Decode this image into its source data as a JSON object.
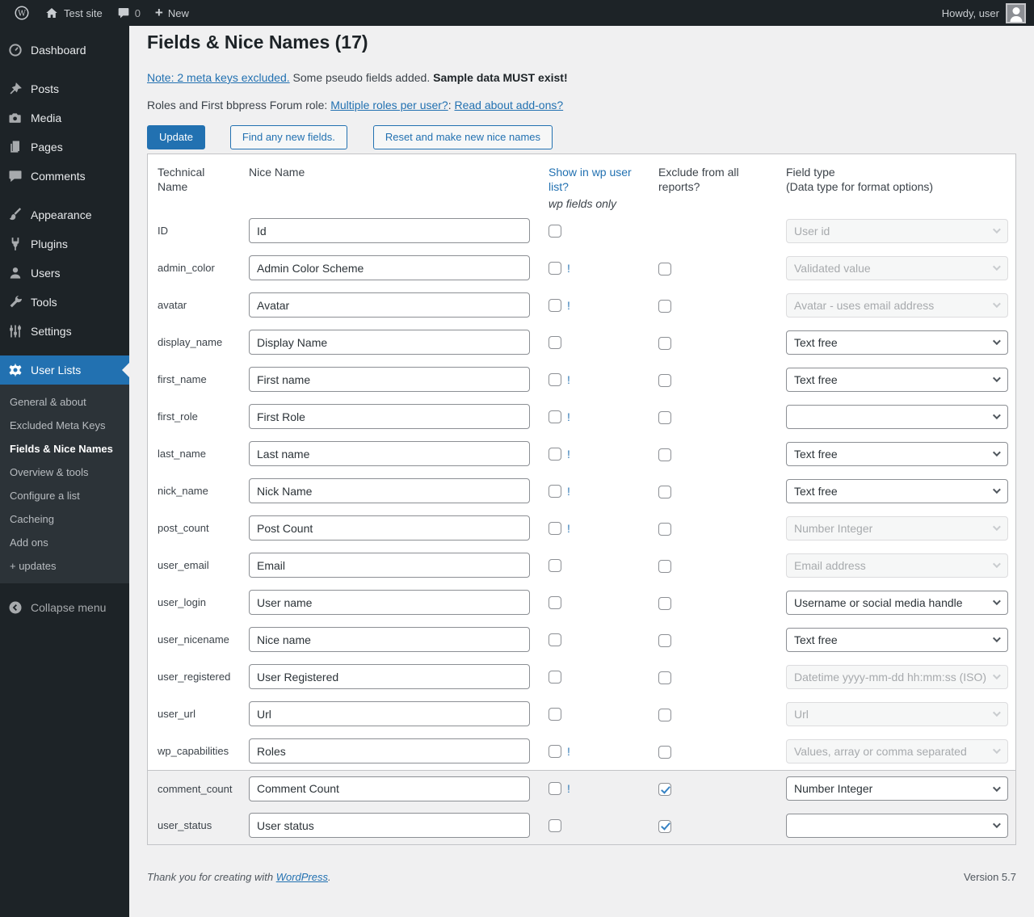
{
  "colors": {
    "accent": "#2271b1",
    "admin_dark": "#1d2327",
    "submenu_bg": "#2c3338",
    "content_bg": "#f0f0f1",
    "check_blue": "#3582c4"
  },
  "admin_bar": {
    "site_name": "Test site",
    "comment_count": "0",
    "new_label": "New",
    "howdy": "Howdy, user"
  },
  "sidebar": {
    "items": [
      {
        "label": "Dashboard",
        "icon": "dashboard-icon",
        "sep": false,
        "active": false
      },
      {
        "label": "Posts",
        "icon": "pushpin-icon",
        "sep": true,
        "active": false
      },
      {
        "label": "Media",
        "icon": "camera-icon",
        "sep": false,
        "active": false
      },
      {
        "label": "Pages",
        "icon": "pages-icon",
        "sep": false,
        "active": false
      },
      {
        "label": "Comments",
        "icon": "comment-icon",
        "sep": false,
        "active": false
      },
      {
        "label": "Appearance",
        "icon": "brush-icon",
        "sep": true,
        "active": false
      },
      {
        "label": "Plugins",
        "icon": "plug-icon",
        "sep": false,
        "active": false
      },
      {
        "label": "Users",
        "icon": "person-icon",
        "sep": false,
        "active": false
      },
      {
        "label": "Tools",
        "icon": "wrench-icon",
        "sep": false,
        "active": false
      },
      {
        "label": "Settings",
        "icon": "sliders-icon",
        "sep": false,
        "active": false
      },
      {
        "label": "User Lists",
        "icon": "gear-icon",
        "sep": true,
        "active": true
      }
    ],
    "submenu": [
      {
        "label": "General & about",
        "current": false
      },
      {
        "label": "Excluded Meta Keys",
        "current": false
      },
      {
        "label": "Fields & Nice Names",
        "current": true
      },
      {
        "label": "Overview & tools",
        "current": false
      },
      {
        "label": "Configure a list",
        "current": false
      },
      {
        "label": "Cacheing",
        "current": false
      },
      {
        "label": "Add ons",
        "current": false
      },
      {
        "label": "+ updates",
        "current": false
      }
    ],
    "collapse_label": "Collapse menu"
  },
  "page": {
    "title": "Fields & Nice Names (17)",
    "note_link": "Note: 2 meta keys excluded.",
    "note_plain": " Some pseudo fields added. ",
    "note_bold": "Sample data MUST exist!",
    "roles_prefix": "Roles and First bbpress Forum role: ",
    "roles_link1": "Multiple roles per user?",
    "roles_colon": ": ",
    "roles_link2": "Read about add-ons?",
    "buttons": {
      "update": "Update",
      "find": "Find any new fields.",
      "reset": "Reset and make new nice names"
    }
  },
  "table": {
    "headers": {
      "technical": "Technical Name",
      "nice": "Nice Name",
      "show_link": "Show in wp user list?",
      "show_sub": "wp fields only",
      "exclude": "Exclude from all reports?",
      "field_type_line1": "Field type",
      "field_type_line2": "(Data type for format options)"
    },
    "warning_char": "!",
    "rows": [
      {
        "tech": "ID",
        "nice": "Id",
        "bang": false,
        "show_checked": false,
        "has_exclude": false,
        "exclude_checked": false,
        "type": "User id",
        "select": "disabled",
        "hl": false
      },
      {
        "tech": "admin_color",
        "nice": "Admin Color Scheme",
        "bang": true,
        "show_checked": false,
        "has_exclude": true,
        "exclude_checked": false,
        "type": "Validated value",
        "select": "disabled",
        "hl": false
      },
      {
        "tech": "avatar",
        "nice": "Avatar",
        "bang": true,
        "show_checked": false,
        "has_exclude": true,
        "exclude_checked": false,
        "type": "Avatar - uses email address",
        "select": "disabled",
        "hl": false
      },
      {
        "tech": "display_name",
        "nice": "Display Name",
        "bang": false,
        "show_checked": false,
        "has_exclude": true,
        "exclude_checked": false,
        "type": "Text free",
        "select": "enabled",
        "hl": false
      },
      {
        "tech": "first_name",
        "nice": "First name",
        "bang": true,
        "show_checked": false,
        "has_exclude": true,
        "exclude_checked": false,
        "type": "Text free",
        "select": "enabled",
        "hl": false
      },
      {
        "tech": "first_role",
        "nice": "First Role",
        "bang": true,
        "show_checked": false,
        "has_exclude": true,
        "exclude_checked": false,
        "type": "",
        "select": "enabled",
        "hl": false
      },
      {
        "tech": "last_name",
        "nice": "Last name",
        "bang": true,
        "show_checked": false,
        "has_exclude": true,
        "exclude_checked": false,
        "type": "Text free",
        "select": "enabled",
        "hl": false
      },
      {
        "tech": "nick_name",
        "nice": "Nick Name",
        "bang": true,
        "show_checked": false,
        "has_exclude": true,
        "exclude_checked": false,
        "type": "Text free",
        "select": "enabled",
        "hl": false
      },
      {
        "tech": "post_count",
        "nice": "Post Count",
        "bang": true,
        "show_checked": false,
        "has_exclude": true,
        "exclude_checked": false,
        "type": "Number Integer",
        "select": "disabled",
        "hl": false
      },
      {
        "tech": "user_email",
        "nice": "Email",
        "bang": false,
        "show_checked": false,
        "has_exclude": true,
        "exclude_checked": false,
        "type": "Email address",
        "select": "disabled",
        "hl": false
      },
      {
        "tech": "user_login",
        "nice": "User name",
        "bang": false,
        "show_checked": false,
        "has_exclude": true,
        "exclude_checked": false,
        "type": "Username or social media handle",
        "select": "enabled",
        "hl": false
      },
      {
        "tech": "user_nicename",
        "nice": "Nice name",
        "bang": false,
        "show_checked": false,
        "has_exclude": true,
        "exclude_checked": false,
        "type": "Text free",
        "select": "enabled",
        "hl": false
      },
      {
        "tech": "user_registered",
        "nice": "User Registered",
        "bang": false,
        "show_checked": false,
        "has_exclude": true,
        "exclude_checked": false,
        "type": "Datetime yyyy-mm-dd hh:mm:ss (ISO)",
        "select": "disabled",
        "hl": false
      },
      {
        "tech": "user_url",
        "nice": "Url",
        "bang": false,
        "show_checked": false,
        "has_exclude": true,
        "exclude_checked": false,
        "type": "Url",
        "select": "disabled",
        "hl": false
      },
      {
        "tech": "wp_capabilities",
        "nice": "Roles",
        "bang": true,
        "show_checked": false,
        "has_exclude": true,
        "exclude_checked": false,
        "type": "Values, array or comma separated",
        "select": "disabled",
        "hl": false
      },
      {
        "tech": "comment_count",
        "nice": "Comment Count",
        "bang": true,
        "show_checked": false,
        "has_exclude": true,
        "exclude_checked": true,
        "type": "Number Integer",
        "select": "enabled",
        "hl": true
      },
      {
        "tech": "user_status",
        "nice": "User status",
        "bang": false,
        "show_checked": false,
        "has_exclude": true,
        "exclude_checked": true,
        "type": "",
        "select": "enabled",
        "hl": true
      }
    ]
  },
  "footer": {
    "thanks_prefix": "Thank you for creating with ",
    "wordpress_link": "WordPress",
    "thanks_suffix": ".",
    "version": "Version 5.7"
  }
}
